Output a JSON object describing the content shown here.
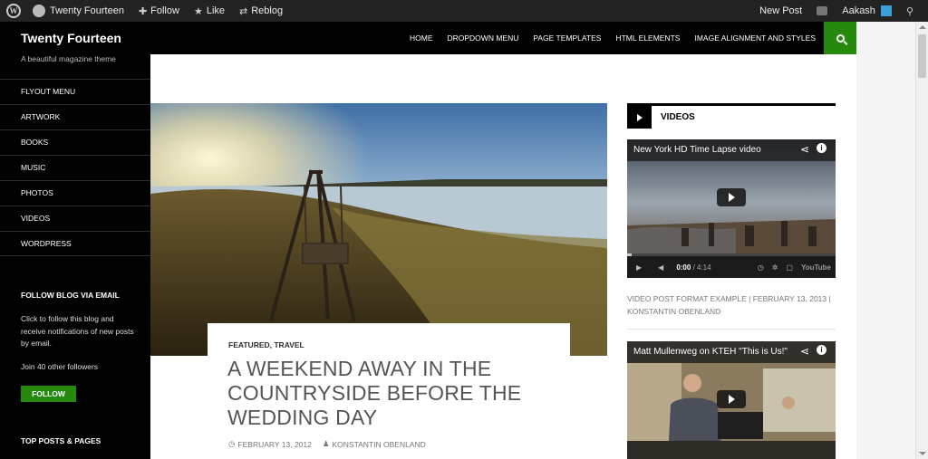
{
  "adminbar": {
    "site_name": "Twenty Fourteen",
    "follow_label": "Follow",
    "like_label": "Like",
    "reblog_label": "Reblog",
    "new_post_label": "New Post",
    "user_name": "Aakash"
  },
  "header": {
    "site_title": "Twenty Fourteen",
    "nav": [
      "HOME",
      "DROPDOWN MENU",
      "PAGE TEMPLATES",
      "HTML ELEMENTS",
      "IMAGE ALIGNMENT AND STYLES"
    ]
  },
  "sidebar": {
    "tagline": "A beautiful magazine theme",
    "menu": [
      "FLYOUT MENU",
      "ARTWORK",
      "BOOKS",
      "MUSIC",
      "PHOTOS",
      "VIDEOS",
      "WORDPRESS"
    ],
    "follow_heading": "FOLLOW BLOG VIA EMAIL",
    "follow_text": "Click to follow this blog and receive notifications of new posts by email.",
    "join_text": "Join 40 other followers",
    "follow_button": "FOLLOW",
    "top_posts_heading": "TOP POSTS & PAGES"
  },
  "post": {
    "categories": "FEATURED, TRAVEL",
    "title": "A WEEKEND AWAY IN THE COUNTRYSIDE BEFORE THE WEDDING DAY",
    "date": "FEBRUARY 13, 2012",
    "author": "KONSTANTIN OBENLAND"
  },
  "widget": {
    "title": "VIDEOS",
    "video1": {
      "title": "New York HD Time Lapse video",
      "time_current": "0:00",
      "time_total": "/ 4:14",
      "progress": 0.0
    },
    "video1_meta": "VIDEO POST FORMAT EXAMPLE | FEBRUARY 13, 2013 | KONSTANTIN OBENLAND",
    "video2": {
      "title": "Matt Mullenweg on KTEH \"This is Us!\""
    },
    "youtube_label": "YouTube"
  },
  "colors": {
    "accent_green": "#24890d",
    "header_black": "#000000",
    "adminbar": "#222222"
  },
  "icons": [
    "wordpress-icon",
    "follow-icon",
    "star-icon",
    "reblog-icon",
    "notification-icon",
    "search-icon",
    "play-icon",
    "share-icon",
    "info-icon",
    "volume-icon",
    "settings-icon",
    "clock-icon",
    "user-icon"
  ]
}
